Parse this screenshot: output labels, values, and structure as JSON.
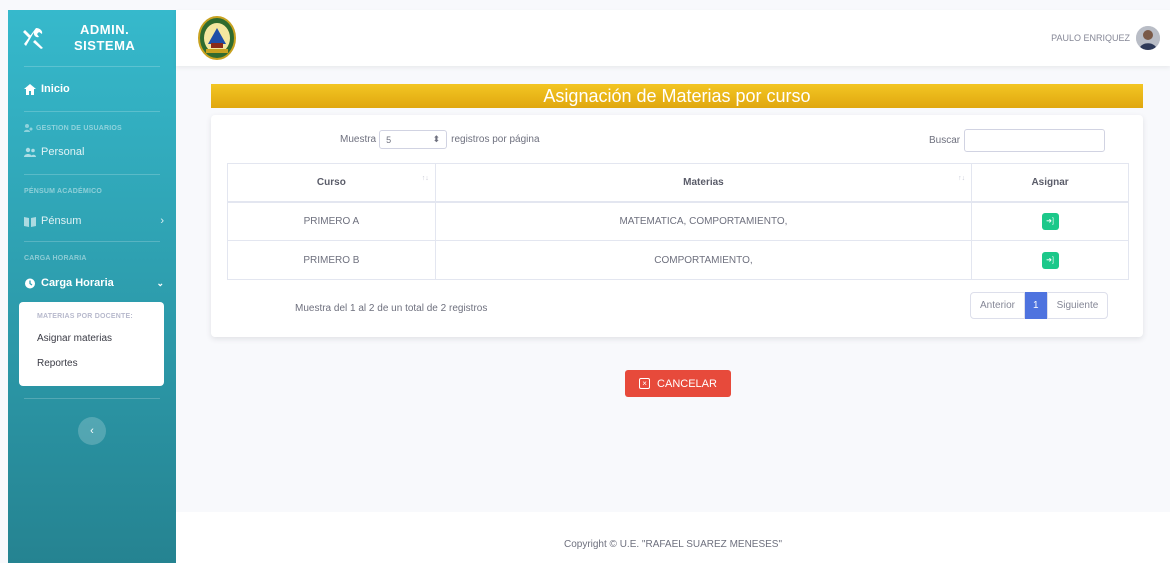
{
  "sidebar": {
    "brand": {
      "line1": "ADMIN.",
      "line2": "SISTEMA"
    },
    "inicio": "Inicio",
    "heading_usuarios": "GESTION DE USUARIOS",
    "personal": "Personal",
    "heading_pensum": "PÉNSUM ACADÉMICO",
    "pensum": "Pénsum",
    "heading_carga": "CARGA HORARIA",
    "carga": "Carga Horaria",
    "submenu": {
      "heading": "MATERIAS POR DOCENTE:",
      "items": [
        "Asignar materias",
        "Reportes"
      ]
    }
  },
  "topbar": {
    "user_name": "PAULO ENRIQUEZ"
  },
  "page": {
    "title": "Asignación de Materias por curso",
    "length_prefix": "Muestra",
    "length_value": "5",
    "length_suffix": "registros por página",
    "search_label": "Buscar",
    "search_value": ""
  },
  "table": {
    "headers": [
      "Curso",
      "Materias",
      "Asignar"
    ],
    "rows": [
      {
        "curso": "PRIMERO A",
        "materias": "MATEMATICA, COMPORTAMIENTO,"
      },
      {
        "curso": "PRIMERO B",
        "materias": "COMPORTAMIENTO,"
      }
    ]
  },
  "pagination": {
    "info": "Muestra del 1 al 2 de un total de 2 registros",
    "prev": "Anterior",
    "current": "1",
    "next": "Siguiente"
  },
  "cancel_label": "CANCELAR",
  "footer": "Copyright © U.E. \"RAFAEL SUAREZ MENESES\"",
  "colors": {
    "sidebar": "#36b9cc",
    "title": "#f3c623",
    "success": "#1cc88a",
    "danger": "#e74a3b",
    "primary": "#4e73df"
  }
}
